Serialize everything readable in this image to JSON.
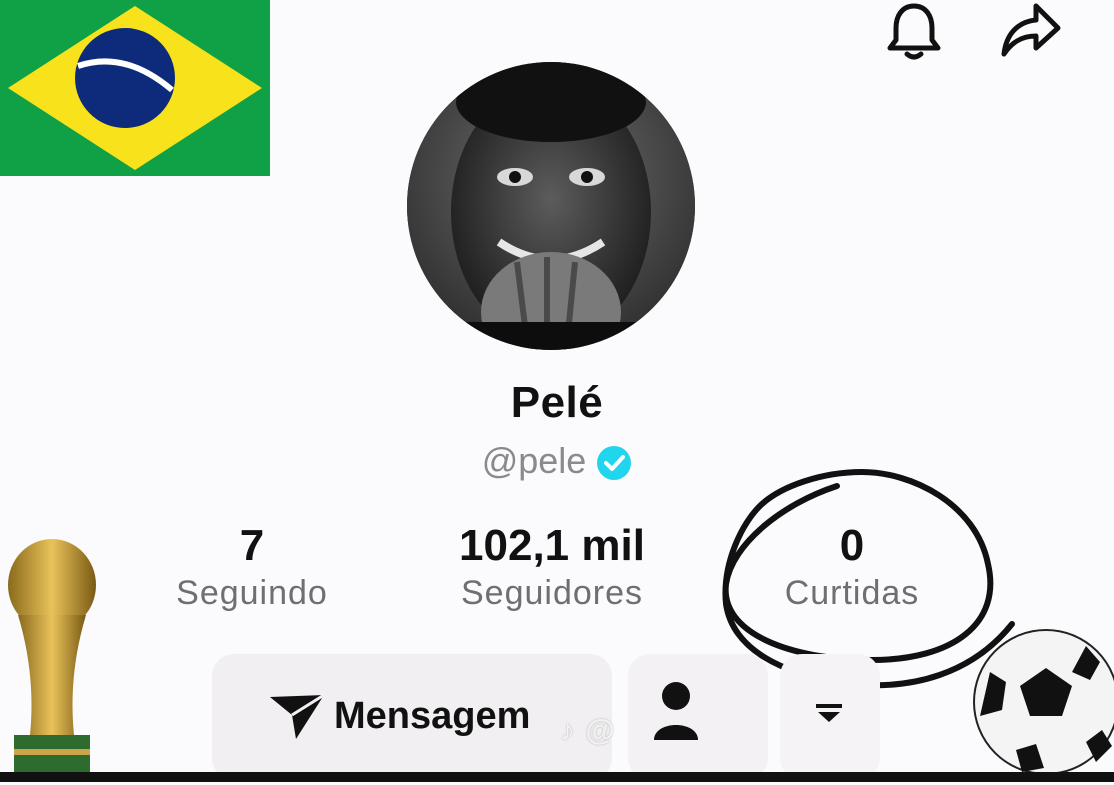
{
  "profile": {
    "name": "Pelé",
    "handle": "@pele",
    "verified": true
  },
  "stats": {
    "following": {
      "value": "7",
      "label": "Seguindo"
    },
    "followers": {
      "value": "102,1 mil",
      "label": "Seguidores"
    },
    "likes": {
      "value": "0",
      "label": "Curtidas"
    }
  },
  "actions": {
    "message_label": "Mensagem"
  },
  "watermark": "♪ @",
  "icons": {
    "bell": "bell-icon",
    "share": "share-arrow-icon",
    "send": "send-icon",
    "person": "person-icon",
    "more": "dropdown-icon"
  },
  "colors": {
    "flag_green": "#009c3b",
    "flag_yellow": "#ffdf00",
    "flag_blue": "#002776",
    "verified": "#20d5ec",
    "annotation": "#111111"
  }
}
